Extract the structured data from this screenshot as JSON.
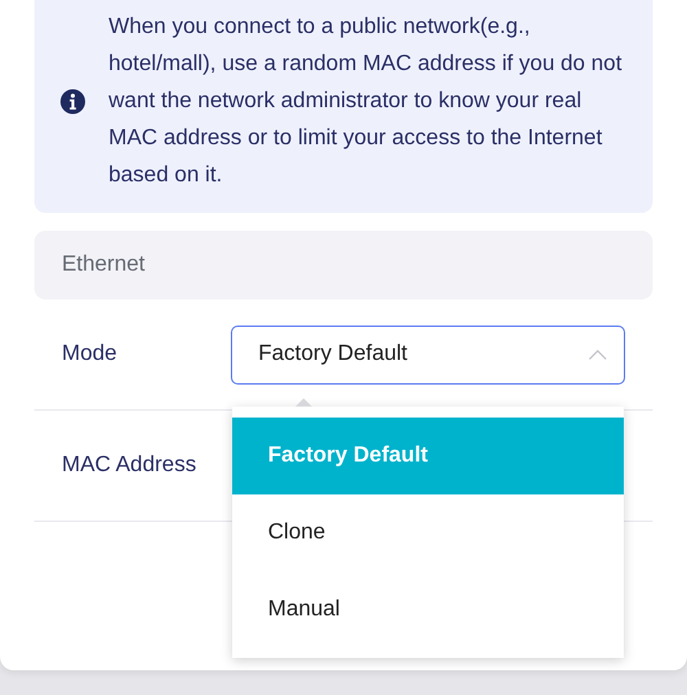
{
  "notice": {
    "text": "When you connect to a public network(e.g., hotel/mall), use a random MAC address if you do not want the network administrator to know your real MAC address or to limit your access to the Internet based on it."
  },
  "section": {
    "title": "Ethernet"
  },
  "fields": [
    {
      "kind": "select",
      "label": "Mode",
      "value": "Factory Default",
      "expanded": true,
      "options": [
        {
          "label": "Factory Default",
          "selected": true
        },
        {
          "label": "Clone",
          "selected": false
        },
        {
          "label": "Manual",
          "selected": false
        }
      ]
    },
    {
      "kind": "plain",
      "label": "MAC Address"
    }
  ]
}
